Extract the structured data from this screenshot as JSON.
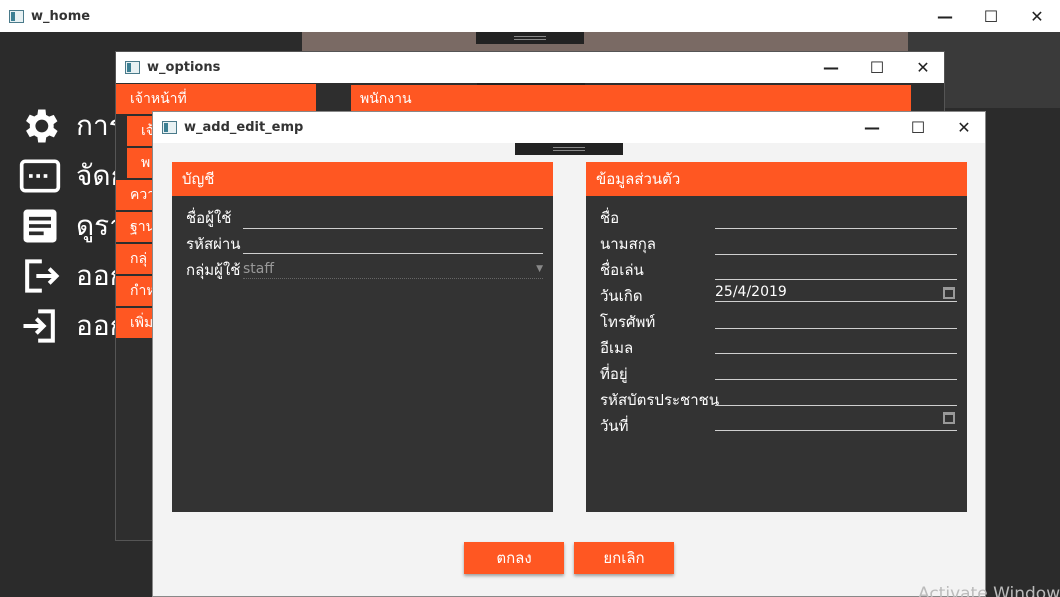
{
  "home_window": {
    "title": "w_home",
    "menu": [
      {
        "icon": "gear-icon",
        "label": "การ"
      },
      {
        "icon": "keyboard-icon",
        "label": "จัดก"
      },
      {
        "icon": "document-icon",
        "label": "ดูรา"
      },
      {
        "icon": "logout-icon",
        "label": "ออก"
      },
      {
        "icon": "login-icon",
        "label": "ออก"
      }
    ]
  },
  "options_window": {
    "title": "w_options",
    "tab_staff": "เจ้าหน้าที่",
    "tab_employee": "พนักงาน",
    "side_items": [
      "เจ้",
      "พ",
      "ควา",
      "ฐาน",
      "กลุ่",
      "กำห",
      "เพิ่ม"
    ]
  },
  "add_edit_window": {
    "title": "w_add_edit_emp",
    "account_panel": {
      "header": "บัญชี",
      "username_label": "ชื่อผู้ใช้",
      "username_value": "",
      "password_label": "รหัสผ่าน",
      "password_value": "",
      "group_label": "กลุ่มผู้ใช้",
      "group_value": "staff"
    },
    "personal_panel": {
      "header": "ข้อมูลส่วนตัว",
      "fields": [
        {
          "label": "ชื่อ",
          "value": ""
        },
        {
          "label": "นามสกุล",
          "value": ""
        },
        {
          "label": "ชื่อเล่น",
          "value": ""
        },
        {
          "label": "วันเกิด",
          "value": "25/4/2019"
        },
        {
          "label": "โทรศัพท์",
          "value": ""
        },
        {
          "label": "อีเมล",
          "value": ""
        },
        {
          "label": "ที่อยู่",
          "value": ""
        },
        {
          "label": "รหัสบัตรประชาชน",
          "value": ""
        },
        {
          "label": "วันที่",
          "value": ""
        }
      ]
    },
    "ok_button": "ตกลง",
    "cancel_button": "ยกเลิก"
  },
  "watermark": "Activate Windows",
  "colors": {
    "accent": "#ff5722",
    "panel": "#333333",
    "dark_bg": "#2b2b2b"
  }
}
